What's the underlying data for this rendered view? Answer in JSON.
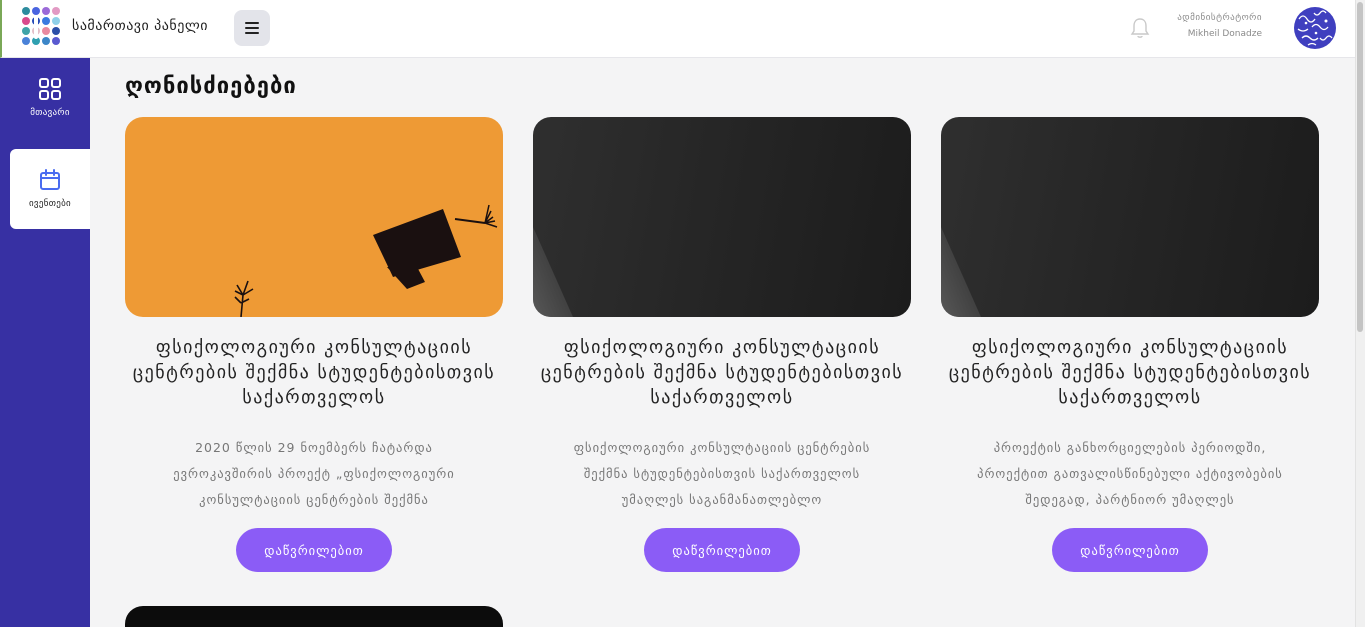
{
  "header": {
    "brand": "სამართავი პანელი",
    "user_role": "ადმინისტრატორი",
    "user_name": "Mikheil Donadze"
  },
  "sidebar": {
    "items": [
      {
        "label": "მთავარი",
        "icon": "grid-icon"
      },
      {
        "label": "ივენთები",
        "icon": "calendar-icon"
      }
    ]
  },
  "page": {
    "title": "ღონისძიებები"
  },
  "cards": [
    {
      "image": "graduation-cap-photo",
      "title": "ფსიქოლოგიური კონსულტაციის ცენტრების შექმნა სტუდენტებისთვის საქართველოს",
      "description": "2020 წლის 29 ნოემბერს ჩატარდა ევროკავშირის პროექტ „ფსიქოლოგიური კონსულტაციის ცენტრების შექმნა",
      "button": "დაწვრილებით"
    },
    {
      "image": "dark-photo",
      "title": "ფსიქოლოგიური კონსულტაციის ცენტრების შექმნა სტუდენტებისთვის საქართველოს",
      "description": "ფსიქოლოგიური კონსულტაციის ცენტრების შექმნა სტუდენტებისთვის საქართველოს უმაღლეს საგანმანათლებლო",
      "button": "დაწვრილებით"
    },
    {
      "image": "dark-photo",
      "title": "ფსიქოლოგიური კონსულტაციის ცენტრების შექმნა სტუდენტებისთვის საქართველოს",
      "description": "პროექტის განხორციელების პერიოდში, პროექტით გათვალისწინებული აქტივობების შედეგად, პარტნიორ უმაღლეს",
      "button": "დაწვრილებით"
    }
  ],
  "colors": {
    "sidebar": "#3730a3",
    "accent_button": "#8b5cf6",
    "card_1_bg": "#ee9a35"
  }
}
